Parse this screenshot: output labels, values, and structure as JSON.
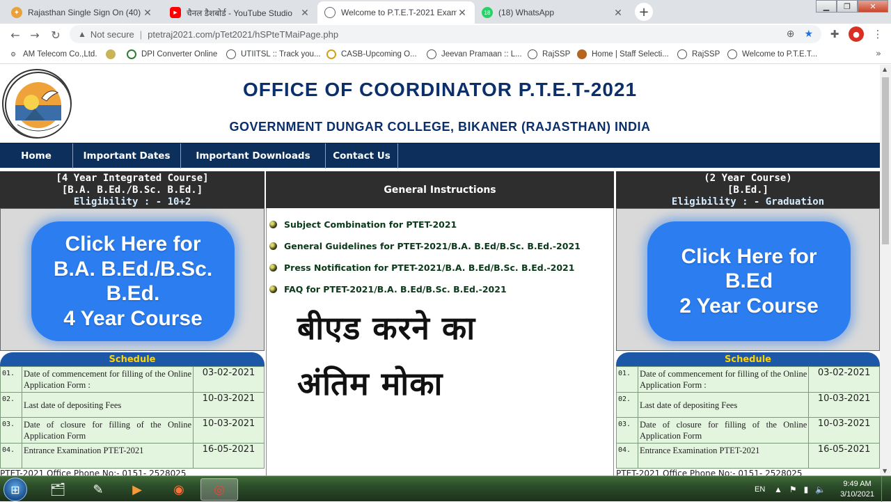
{
  "browser": {
    "tabs": [
      {
        "title": "Rajasthan Single Sign On (40)",
        "icon": "rajasthan-emblem-icon"
      },
      {
        "title": "चैनल डैशबोर्ड - YouTube Studio",
        "icon": "youtube-icon"
      },
      {
        "title": "Welcome to P.T.E.T-2021 Examinat",
        "icon": "globe-icon"
      },
      {
        "title": "(18) WhatsApp",
        "icon": "whatsapp-icon"
      }
    ],
    "security_label": "Not secure",
    "url": "ptetraj2021.com/pTet2021/hSPteTMaiPage.php",
    "bookmarks": [
      "AM Telecom Co.,Ltd.",
      "",
      "DPI Converter Online",
      "UTIITSL :: Track you...",
      "CASB-Upcoming O...",
      "Jeevan Pramaan :: L...",
      "RajSSP",
      "Home | Staff Selecti...",
      "RajSSP",
      "Welcome to P.T.E.T..."
    ]
  },
  "page": {
    "title": "OFFICE OF COORDINATOR P.T.E.T-2021",
    "subtitle": "GOVERNMENT DUNGAR COLLEGE, BIKANER (RAJASTHAN) INDIA",
    "nav": [
      "Home",
      "Important Dates",
      "Important Downloads",
      "Contact Us"
    ],
    "left_course": {
      "line1": "[4 Year Integrated Course]",
      "line2": "[B.A. B.Ed./B.Sc. B.Ed.]",
      "eligibility": "Eligibility : - 10+2",
      "button_lines": [
        "Click Here for",
        "B.A. B.Ed./B.Sc.",
        "B.Ed.",
        "4 Year Course"
      ]
    },
    "right_course": {
      "line1": "(2 Year Course)",
      "line2": "[B.Ed.]",
      "eligibility": "Eligibility : - Graduation",
      "button_lines": [
        "Click Here for",
        "B.Ed",
        "2 Year Course"
      ]
    },
    "general_instructions": {
      "heading": "General Instructions",
      "items": [
        "Subject Combination for PTET-2021",
        "General Guidelines for PTET-2021/B.A. B.Ed/B.Sc. B.Ed.-2021",
        "Press Notification for PTET-2021/B.A. B.Ed/B.Sc. B.Ed.-2021",
        "FAQ for PTET-2021/B.A. B.Ed/B.Sc. B.Ed.-2021"
      ]
    },
    "overlay_text": [
      "बीएड करने  का",
      "अंतिम मोका"
    ],
    "schedule": {
      "heading": "Schedule",
      "rows": [
        {
          "no": "01.",
          "desc": "Date of commencement for filling of the Online Application Form :",
          "date": "03-02-2021"
        },
        {
          "no": "02.",
          "desc": "Last date of depositing Fees",
          "date": "10-03-2021"
        },
        {
          "no": "03.",
          "desc": "Date of closure for filling of the Online Application Form",
          "date": "10-03-2021"
        },
        {
          "no": "04.",
          "desc": "Entrance Examination PTET-2021",
          "date": "16-05-2021"
        }
      ]
    },
    "phone_line": "PTET-2021 Office Phone No:- 0151- 2528025"
  },
  "taskbar": {
    "language": "EN",
    "time": "9:49 AM",
    "date": "3/10/2021"
  },
  "colors": {
    "header_blue": "#0b2f6b",
    "nav_bg": "#0d2f5c",
    "button_blue": "#2b7df0",
    "schedule_yellow": "#ffd400",
    "schedule_bg": "#e3f5df"
  }
}
